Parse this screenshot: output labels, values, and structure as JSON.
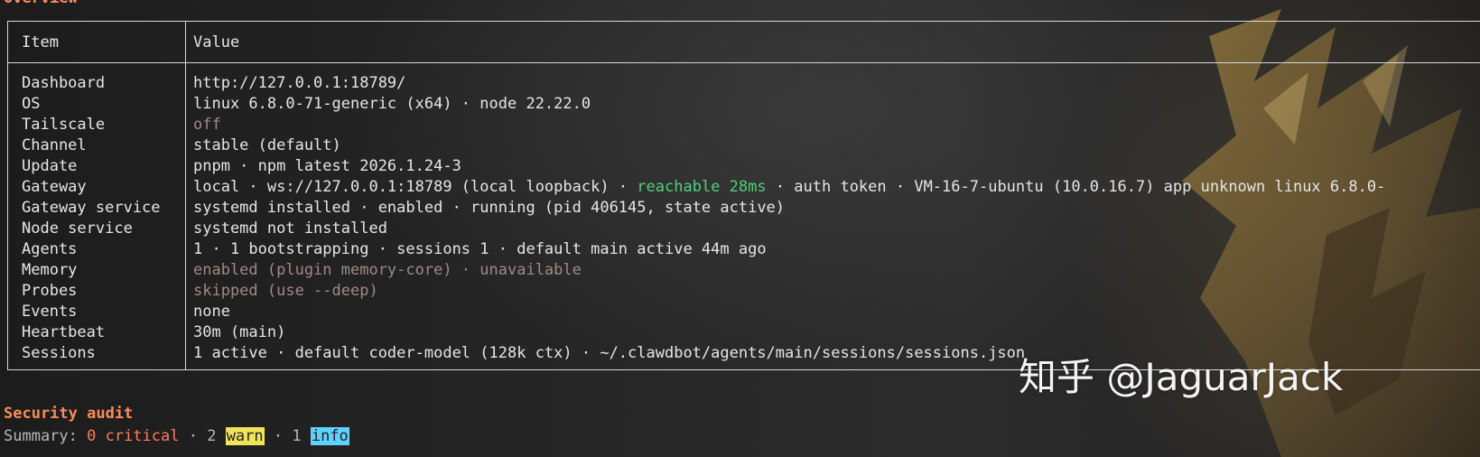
{
  "overview": {
    "title": "Overview",
    "headers": {
      "item": "Item",
      "value": "Value"
    },
    "rows": [
      {
        "item": "Dashboard",
        "value": "http://127.0.0.1:18789/"
      },
      {
        "item": "OS",
        "value": "linux 6.8.0-71-generic (x64) · node 22.22.0"
      },
      {
        "item": "Tailscale",
        "value": "off"
      },
      {
        "item": "Channel",
        "value": "stable (default)"
      },
      {
        "item": "Update",
        "value": "pnpm · npm latest 2026.1.24-3"
      },
      {
        "item": "Gateway",
        "value_prefix": "local · ws://127.0.0.1:18789 (local loopback) · ",
        "value_status": "reachable 28ms",
        "value_suffix": " · auth token · VM-16-7-ubuntu (10.0.16.7) app unknown linux 6.8.0-"
      },
      {
        "item": "Gateway service",
        "value": "systemd installed · enabled · running (pid 406145, state active)"
      },
      {
        "item": "Node service",
        "value": "systemd not installed"
      },
      {
        "item": "Agents",
        "value": "1 · 1 bootstrapping · sessions 1 · default main active 44m ago"
      },
      {
        "item": "Memory",
        "value": "enabled (plugin memory-core) · unavailable"
      },
      {
        "item": "Probes",
        "value": "skipped (use --deep)"
      },
      {
        "item": "Events",
        "value": "none"
      },
      {
        "item": "Heartbeat",
        "value": "30m (main)"
      },
      {
        "item": "Sessions",
        "value": "1 active · default coder-model (128k ctx) · ~/.clawdbot/agents/main/sessions/sessions.json"
      }
    ]
  },
  "security": {
    "title": "Security audit",
    "summary_label": "Summary: ",
    "critical": "0 critical",
    "sep1": " · ",
    "warn_count": "2 ",
    "warn": "warn",
    "sep2": " · ",
    "info_count": "1 ",
    "info": "info"
  },
  "watermark": "知乎 @JaguarJack",
  "colors": {
    "section_title": "#ff8a5c",
    "dim_text": "#a08a84",
    "ok_text": "#4fd07a",
    "warn_badge": "#f2e45a",
    "info_badge": "#5fd3ff"
  }
}
